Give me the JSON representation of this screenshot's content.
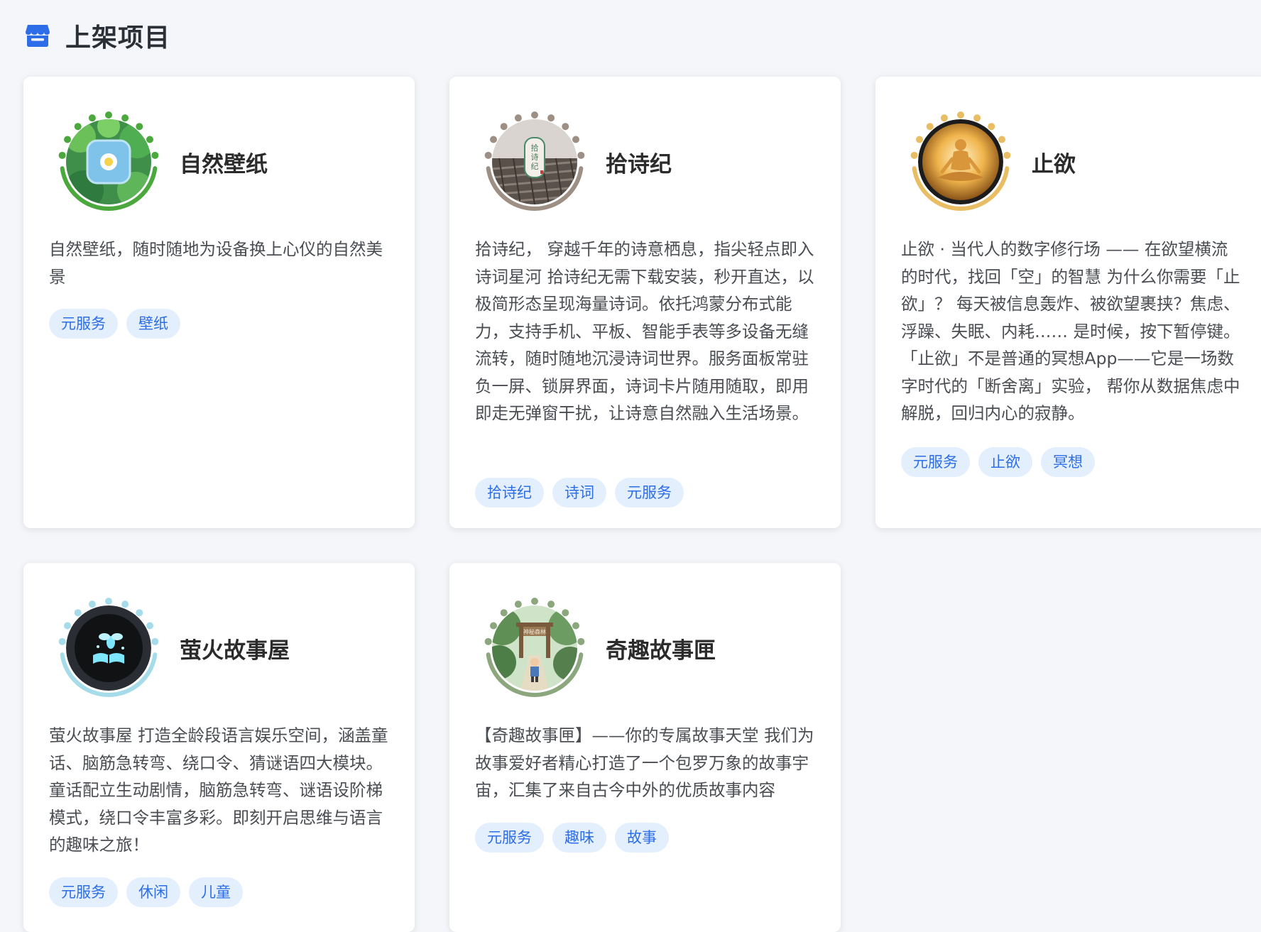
{
  "header": {
    "title": "上架项目",
    "icon": "store-icon",
    "icon_color": "#2d6ee8"
  },
  "cards": [
    {
      "name": "自然壁纸",
      "description": "自然壁纸，随时随地为设备换上心仪的自然美景",
      "tags": [
        "元服务",
        "壁纸"
      ],
      "ring_color": "#4aa83c",
      "icon": "nature-wallpaper-app-icon"
    },
    {
      "name": "拾诗纪",
      "description": "拾诗纪， 穿越千年的诗意栖息，指尖轻点即入诗词星河 拾诗纪无需下载安装，秒开直达，以极简形态呈现海量诗词。依托鸿蒙分布式能力，支持手机、平板、智能手表等多设备无缝流转，随时随地沉浸诗词世界。服务面板常驻负一屏、锁屏界面，诗词卡片随用随取，即用即走无弹窗干扰，让诗意自然融入生活场景。",
      "tags": [
        "拾诗纪",
        "诗词",
        "元服务"
      ],
      "ring_color": "#9e8f84",
      "icon": "poetry-app-icon"
    },
    {
      "name": "止欲",
      "description": "止欲 · 当代人的数字修行场 —— 在欲望横流的时代，找回「空」的智慧 为什么你需要「止欲」？ 每天被信息轰炸、被欲望裹挟？焦虑、浮躁、失眠、内耗…… 是时候，按下暂停键。 「止欲」不是普通的冥想App——它是一场数字时代的「断舍离」实验， 帮你从数据焦虑中解脱，回归内心的寂静。",
      "tags": [
        "元服务",
        "止欲",
        "冥想"
      ],
      "ring_color": "#e8bd64",
      "icon": "meditation-app-icon"
    },
    {
      "name": "萤火故事屋",
      "description": "萤火故事屋 打造全龄段语言娱乐空间，涵盖童话、脑筋急转弯、绕口令、猜谜语四大模块。童话配立生动剧情，脑筋急转弯、谜语设阶梯模式，绕口令丰富多彩。即刻开启思维与语言的趣味之旅！",
      "tags": [
        "元服务",
        "休闲",
        "儿童"
      ],
      "ring_color": "#a6dcea",
      "icon": "firefly-book-app-icon"
    },
    {
      "name": "奇趣故事匣",
      "description": "【奇趣故事匣】——你的专属故事天堂 我们为故事爱好者精心打造了一个包罗万象的故事宇宙，汇集了来自古今中外的优质故事内容",
      "tags": [
        "元服务",
        "趣味",
        "故事"
      ],
      "ring_color": "#8ca67e",
      "icon": "forest-story-app-icon",
      "sign_text": "神秘森林"
    }
  ]
}
